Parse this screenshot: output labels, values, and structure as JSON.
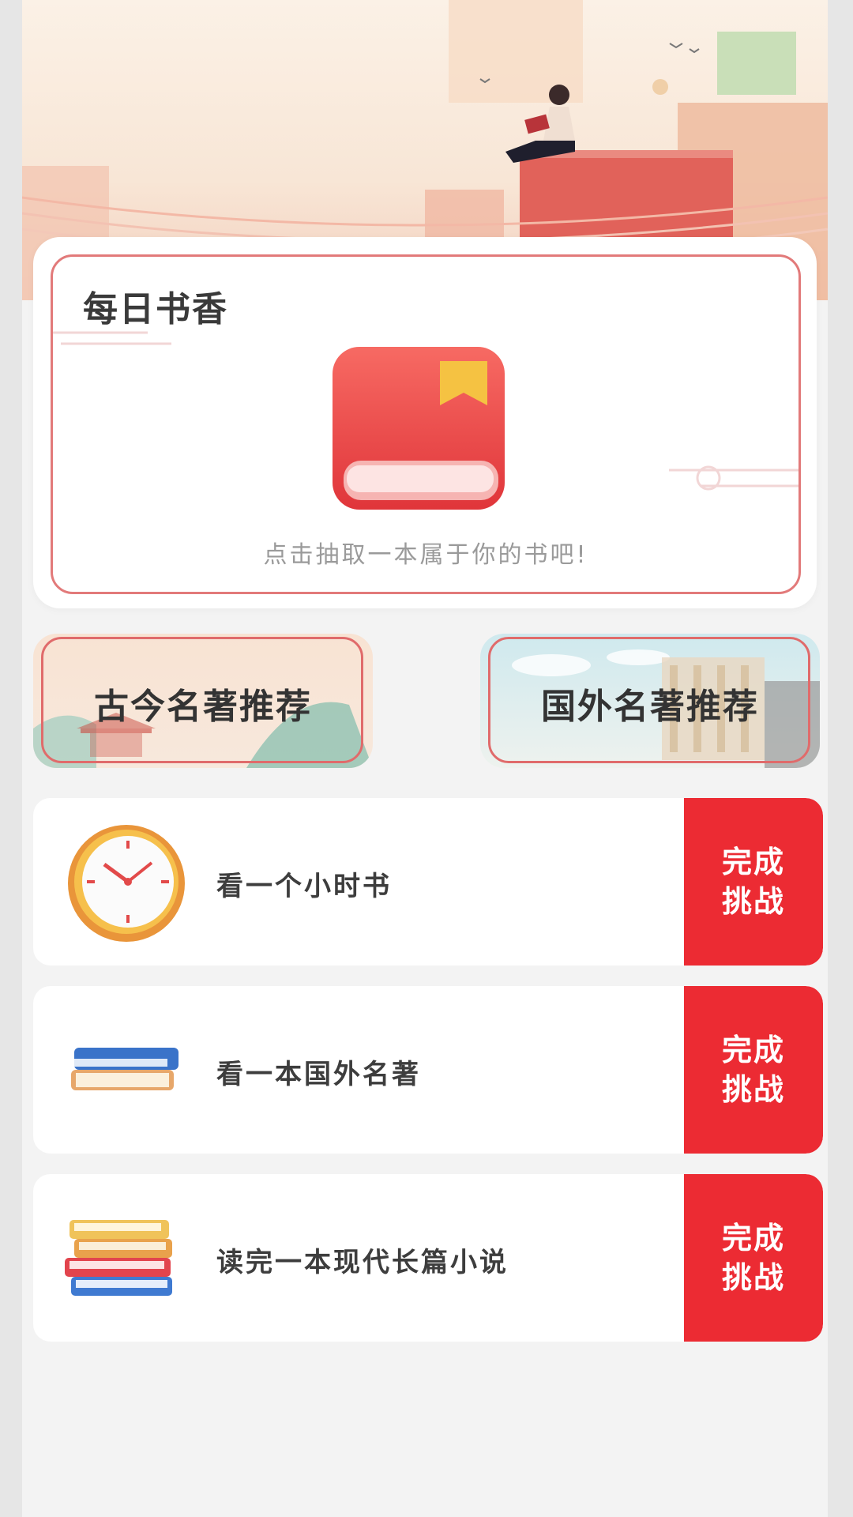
{
  "daily": {
    "title": "每日书香",
    "hint": "点击抽取一本属于你的书吧!"
  },
  "recommend": [
    {
      "label": "古今名著推荐"
    },
    {
      "label": "国外名著推荐"
    }
  ],
  "tasks": [
    {
      "text": "看一个小时书",
      "icon": "clock-icon",
      "button_line1": "完成",
      "button_line2": "挑战"
    },
    {
      "text": "看一本国外名著",
      "icon": "book-stack-icon",
      "button_line1": "完成",
      "button_line2": "挑战"
    },
    {
      "text": "读完一本现代长篇小说",
      "icon": "books-pile-icon",
      "button_line1": "完成",
      "button_line2": "挑战"
    }
  ],
  "colors": {
    "accent_red": "#ec2b33",
    "card_border": "#e27a7a",
    "background": "#f3f3f3"
  }
}
